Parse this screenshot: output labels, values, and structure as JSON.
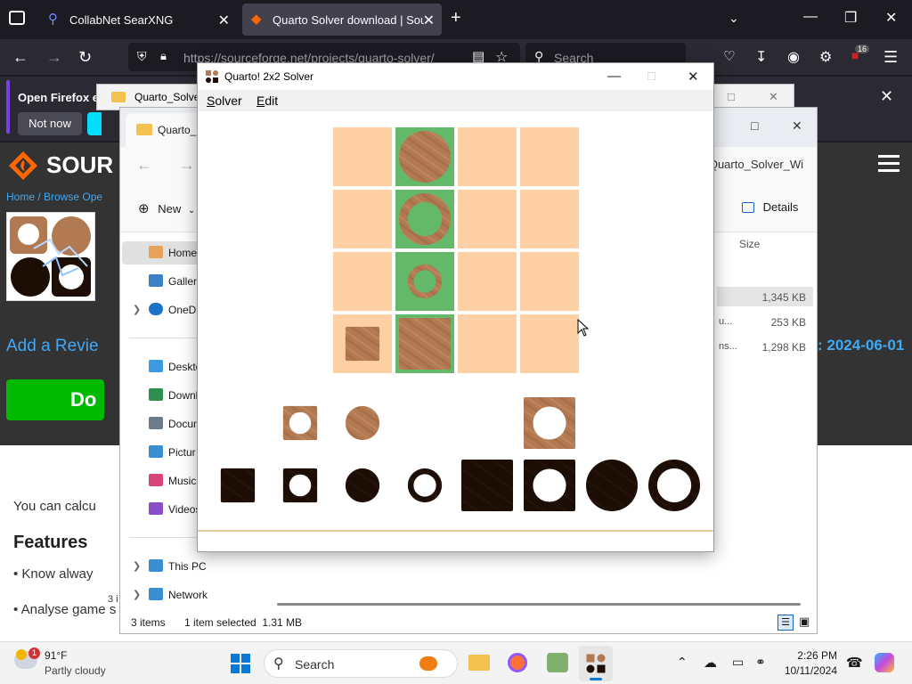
{
  "browser": {
    "tabs": [
      {
        "title": "CollabNet SearXNG",
        "active": false
      },
      {
        "title": "Quarto Solver download | Sourc",
        "active": true
      }
    ],
    "url": "https://sourceforge.net/projects/quarto-solver/",
    "search_placeholder": "Search",
    "extension_badge": "16",
    "notice": {
      "title": "Open Firefox ev",
      "not_now": "Not now"
    }
  },
  "sourceforge": {
    "logo_text": "SOUR",
    "breadcrumb": "Home / Browse Ope",
    "add_review": "Add a Revie",
    "date": ": 2024-06-01",
    "download_label": "Do",
    "calc_text": "You can calcu",
    "features_heading": "Features",
    "bullets": [
      "• Know alway",
      "• Analyse game s"
    ]
  },
  "explorer_back": {
    "title": "Quarto_Solve"
  },
  "explorer": {
    "tab_title": "Quarto_",
    "path": "n Quarto_Solver_Wi",
    "new_label": "New",
    "details_label": "Details",
    "nav": [
      {
        "label": "Home",
        "icon": "home-icon",
        "color": "#e6a15a"
      },
      {
        "label": "Gallery",
        "icon": "gallery-icon",
        "color": "#3b82c4"
      },
      {
        "label": "OneDrive",
        "icon": "onedrive-icon",
        "color": "#1a73c8"
      },
      {
        "label": "Desktop",
        "icon": "desktop-icon",
        "color": "#3b9ae1"
      },
      {
        "label": "Downloads",
        "icon": "downloads-icon",
        "color": "#2f8f4f"
      },
      {
        "label": "Documents",
        "icon": "documents-icon",
        "color": "#6b7b8c"
      },
      {
        "label": "Pictures",
        "icon": "pictures-icon",
        "color": "#3a8ed4"
      },
      {
        "label": "Music",
        "icon": "music-icon",
        "color": "#d6457a"
      },
      {
        "label": "Videos",
        "icon": "videos-icon",
        "color": "#8a4fc7"
      },
      {
        "label": "This PC",
        "icon": "this-pc-icon",
        "color": "#3a8ed4"
      },
      {
        "label": "Network",
        "icon": "network-icon",
        "color": "#3a8ed4"
      }
    ],
    "nav_visible_text": [
      "Home",
      "Galler",
      "OneDr",
      "Deskto",
      "Downl",
      "Docun",
      "Pictur",
      "Music",
      "Videos",
      "This PC",
      "Network"
    ],
    "size_header": "Size",
    "files": [
      {
        "name": "",
        "size": "1,345 KB",
        "selected": true
      },
      {
        "name": "u...",
        "size": "253 KB",
        "selected": false
      },
      {
        "name": "ns...",
        "size": "1,298 KB",
        "selected": false
      }
    ],
    "status": {
      "items": "3 items",
      "selected": "1 item selected  1.31 MB",
      "left_partial": "3 i"
    }
  },
  "quarto": {
    "title": "Quarto! 2x2 Solver",
    "menu": [
      {
        "label": "Solver",
        "underline": "S",
        "rest": "olver"
      },
      {
        "label": "Edit",
        "underline": "E",
        "rest": "dit"
      }
    ],
    "colors": {
      "empty_cell": "#ffd0a3",
      "highlight_cell": "#63b86a",
      "light_piece": "#b27a52",
      "dark_piece": "#1c0d05"
    },
    "board": [
      [
        null,
        {
          "color": "light",
          "shape": "round",
          "size": "tall",
          "fill": "solid"
        },
        null,
        null
      ],
      [
        null,
        {
          "color": "light",
          "shape": "round",
          "size": "tall",
          "fill": "hollow"
        },
        null,
        null
      ],
      [
        null,
        {
          "color": "light",
          "shape": "round",
          "size": "short",
          "fill": "hollow"
        },
        null,
        null
      ],
      [
        {
          "color": "light",
          "shape": "square",
          "size": "short",
          "fill": "solid"
        },
        {
          "color": "light",
          "shape": "square",
          "size": "tall",
          "fill": "solid"
        },
        null,
        null
      ]
    ],
    "highlight_column": 1,
    "available_pieces": [
      {
        "color": "light",
        "shape": "square",
        "size": "short",
        "fill": "hollow"
      },
      {
        "color": "light",
        "shape": "round",
        "size": "short",
        "fill": "solid"
      },
      {
        "color": "light",
        "shape": "square",
        "size": "tall",
        "fill": "hollow"
      },
      {
        "color": "dark",
        "shape": "square",
        "size": "short",
        "fill": "solid"
      },
      {
        "color": "dark",
        "shape": "square",
        "size": "short",
        "fill": "hollow"
      },
      {
        "color": "dark",
        "shape": "round",
        "size": "short",
        "fill": "solid"
      },
      {
        "color": "dark",
        "shape": "round",
        "size": "short",
        "fill": "hollow"
      },
      {
        "color": "dark",
        "shape": "square",
        "size": "tall",
        "fill": "solid"
      },
      {
        "color": "dark",
        "shape": "square",
        "size": "tall",
        "fill": "hollow"
      },
      {
        "color": "dark",
        "shape": "round",
        "size": "tall",
        "fill": "solid"
      },
      {
        "color": "dark",
        "shape": "round",
        "size": "tall",
        "fill": "hollow"
      }
    ]
  },
  "taskbar": {
    "weather_temp": "91°F",
    "weather_cond": "Partly cloudy",
    "weather_badge": "1",
    "search": "Search",
    "time": "2:26 PM",
    "date": "10/11/2024"
  }
}
